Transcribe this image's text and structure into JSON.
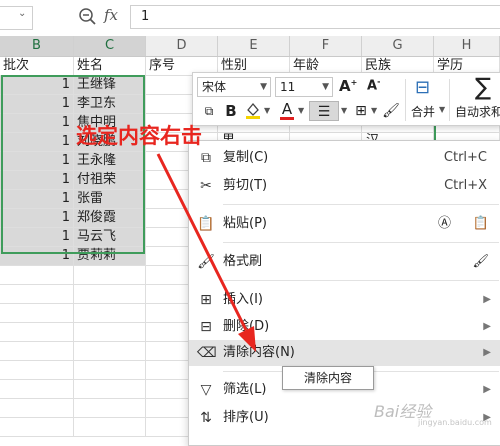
{
  "formula_bar": {
    "name_box": "",
    "fx_label": "fx",
    "value": "1"
  },
  "columns": [
    "B",
    "C",
    "D",
    "E",
    "F",
    "G",
    "H"
  ],
  "header_row": [
    "批次",
    "姓名",
    "序号",
    "性别",
    "年龄",
    "民族",
    "学历"
  ],
  "rows": [
    {
      "batch": "1",
      "name": "王继锋"
    },
    {
      "batch": "1",
      "name": "李卫东"
    },
    {
      "batch": "1",
      "name": "焦中明"
    },
    {
      "batch": "1",
      "name": "刘晓鹏"
    },
    {
      "batch": "1",
      "name": "王永隆"
    },
    {
      "batch": "1",
      "name": "付祖荣"
    },
    {
      "batch": "1",
      "name": "张雷"
    },
    {
      "batch": "1",
      "name": "郑俊霞"
    },
    {
      "batch": "1",
      "name": "马云飞"
    },
    {
      "batch": "1",
      "name": "贾莉莉"
    }
  ],
  "partial_cells": {
    "e_row4": "男",
    "g_row4": "汉"
  },
  "annotation": "选定内容右击",
  "mini_toolbar": {
    "font_name": "宋体",
    "font_size": "11",
    "merge_label": "合并",
    "autosum_label": "自动求和"
  },
  "context_menu": [
    {
      "label": "复制(C)",
      "shortcut": "Ctrl+C",
      "icon": "copy-icon"
    },
    {
      "label": "剪切(T)",
      "shortcut": "Ctrl+X",
      "icon": "scissors-icon"
    },
    {
      "label": "粘贴(P)",
      "shortcut": "",
      "icon": "paste-icon"
    },
    {
      "label": "格式刷",
      "shortcut": "",
      "icon": "format-brush-icon"
    },
    {
      "label": "插入(I)",
      "shortcut": "",
      "icon": "insert-icon"
    },
    {
      "label": "删除(D)",
      "shortcut": "",
      "icon": "delete-icon"
    },
    {
      "label": "清除内容(N)",
      "shortcut": "",
      "icon": "eraser-icon"
    },
    {
      "label": "筛选(L)",
      "shortcut": "",
      "icon": "filter-icon"
    },
    {
      "label": "排序(U)",
      "shortcut": "",
      "icon": "sort-icon"
    }
  ],
  "tooltip": "清除内容",
  "watermark": "Bai经验",
  "watermark_sub": "jingyan.baidu.com",
  "colors": {
    "selection_border": "#3f9c5b",
    "annotation": "#e8261f",
    "arrow": "#e8261f"
  }
}
